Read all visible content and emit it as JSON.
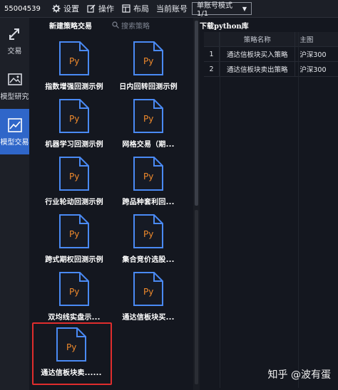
{
  "topbar": {
    "account_id": "55004539",
    "settings_label": "设置",
    "operate_label": "操作",
    "layout_label": "布局",
    "current_account_label": "当前账号",
    "mode_select_value": "单账号模式 1/1"
  },
  "leftnav": {
    "items": [
      {
        "label": "交易",
        "icon": "arrows-icon"
      },
      {
        "label": "模型研究",
        "icon": "image-icon"
      },
      {
        "label": "模型交易",
        "icon": "chart-icon"
      }
    ]
  },
  "strategy_panel": {
    "title": "新建策略交易",
    "search_placeholder": "搜索策略",
    "file_badge": "Py",
    "cards": [
      {
        "label": "指数增强回测示例"
      },
      {
        "label": "日内回转回测示例"
      },
      {
        "label": "机器学习回测示例"
      },
      {
        "label": "网格交易（期..."
      },
      {
        "label": "行业轮动回测示例"
      },
      {
        "label": "跨品种套利回..."
      },
      {
        "label": "跨式期权回测示例"
      },
      {
        "label": "集合竞价选股..."
      },
      {
        "label": "双均线实盘示..."
      },
      {
        "label": "通达信板块买..."
      },
      {
        "label": "通达信板块卖......"
      }
    ]
  },
  "right_panel": {
    "title": "下载python库",
    "columns": [
      "策略名称",
      "主图"
    ],
    "rows": [
      {
        "index": "1",
        "name": "通达信板块买入策略",
        "ref": "沪深300"
      },
      {
        "index": "2",
        "name": "通达信板块卖出策略",
        "ref": "沪深300"
      }
    ]
  },
  "watermark": "知乎 @波有蛋",
  "colors": {
    "accent": "#2f66c9",
    "file_stroke": "#4a8af4",
    "file_text": "#f08a2c",
    "highlight": "#e02d2d"
  }
}
